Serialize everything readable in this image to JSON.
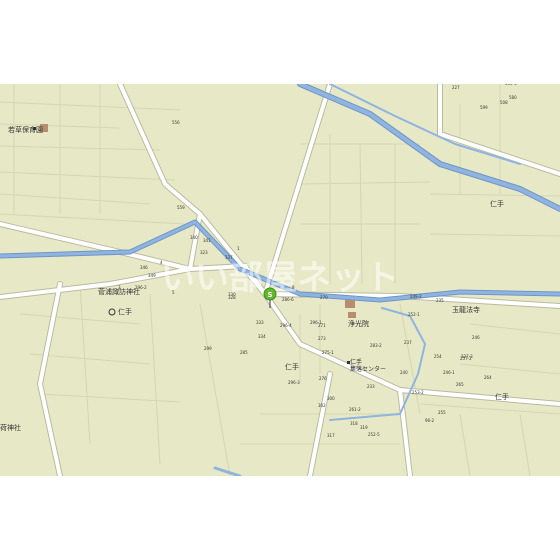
{
  "map": {
    "colors": {
      "land": "#e7e9c6",
      "road": "#ffffff",
      "road_edge": "#b9bba0",
      "river": "#8fb4e0",
      "river_edge": "#6f95c8",
      "parcel": "#d3d5b4",
      "building": "#b88d6e",
      "marker": "#62b82b",
      "watermark": "#ffffff"
    },
    "watermark": "いい部屋ネット",
    "marker": {
      "label": "S",
      "icon": "location-pin-icon"
    },
    "place_labels": [
      {
        "id": "wakakusa-hoikuen",
        "text": "若草保育園"
      },
      {
        "id": "sugaura-suwa-jinja",
        "text": "菅浦諏訪神社"
      },
      {
        "id": "nite-1",
        "text": "仁手"
      },
      {
        "id": "nite-2",
        "text": "仁手"
      },
      {
        "id": "nite-3",
        "text": "仁手"
      },
      {
        "id": "nite-4",
        "text": "仁手"
      },
      {
        "id": "jokoin",
        "text": "浄光院"
      },
      {
        "id": "gyokuhoji",
        "text": "玉龍法寺"
      },
      {
        "id": "nite-shuraku-center",
        "text": "仁手\n集落センター"
      },
      {
        "id": "inari-jinja",
        "text": "荷神社"
      }
    ],
    "lot_numbers": [
      "227",
      "556",
      "580",
      "599",
      "559",
      "341",
      "340",
      "323",
      "337",
      "1",
      "4",
      "349",
      "346",
      "330",
      "296-2",
      "5",
      "3",
      "286-6",
      "8",
      "328",
      "333",
      "334",
      "296-4",
      "296-1",
      "270",
      "271",
      "275-1",
      "273",
      "283-2",
      "296-3",
      "299",
      "285",
      "276",
      "300",
      "302",
      "261-2",
      "233",
      "235",
      "249-2",
      "237",
      "252-1",
      "257-2",
      "317",
      "318",
      "319",
      "252-5",
      "240",
      "246-1",
      "255",
      "227-3",
      "264",
      "265",
      "253-2",
      "254",
      "246",
      "96-2",
      "500-4",
      "508"
    ]
  }
}
